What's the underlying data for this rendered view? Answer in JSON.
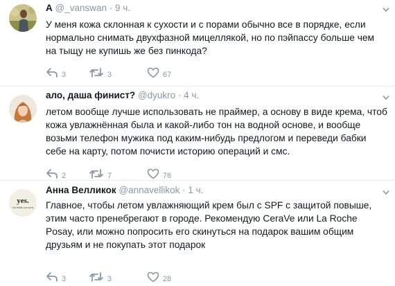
{
  "tweets": [
    {
      "name": "А",
      "handle": "@_vanswan",
      "dot": "·",
      "time": "9 ч.",
      "lines": [
        "У меня кожа склонная к сухости и с порами обычно все в порядке, если",
        "нормально снимать двухфазной мицеллякой, но по пэйпассу больше чем",
        "на тыщу не купишь же без пинкода?"
      ],
      "replies": "3",
      "retweets": "3",
      "likes": "67"
    },
    {
      "name": "ало, даша финист?",
      "handle": "@dyukro",
      "dot": "·",
      "time": "4 ч.",
      "lines": [
        "летом вообще лучше использовать не праймер, а основу в виде крема, чтоб",
        "кожа увлажнённая была и какой-либо тон на водной основе, и вообще",
        "возьми телефон мужика под каким-нибудь предлогом и переведи бабки",
        "себе на карту, потом почисти историю операций и смс."
      ],
      "replies": "2",
      "retweets": "7",
      "likes": "76"
    },
    {
      "name": "Анна Велликок",
      "handle": "@annavellikok",
      "dot": "·",
      "time": "1 ч.",
      "avatar_text": "yes.",
      "avatar_subtext": "i do think you suck.",
      "lines": [
        "Главное, чтобы летом увлажняющий крем был с SPF с защитой повыше,",
        "этим часто пренебрегают в городе. Рекомендую CeraVe или La Roche",
        "Posay, или можно попросить его скинуться на подарок вашим общим",
        "друзьям и не покупать этот подарок"
      ],
      "replies": "3",
      "retweets": "3",
      "likes": "28"
    }
  ],
  "icons": [
    "reply-icon",
    "retweet-icon",
    "like-icon",
    "caret-down-icon"
  ],
  "colors": {
    "icon": "#8899a6",
    "text": "#14171a",
    "separator": "#e6ecf0"
  }
}
